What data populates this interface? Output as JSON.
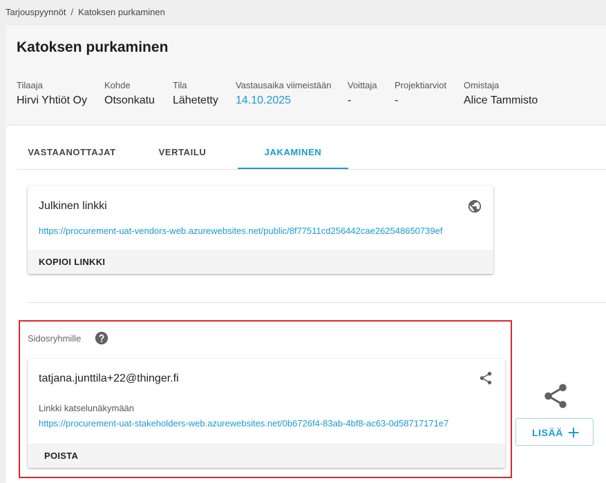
{
  "breadcrumb": {
    "items": [
      "Tarjouspyynnöt",
      "Katoksen purkaminen"
    ],
    "separator": "/"
  },
  "page": {
    "title": "Katoksen purkaminen"
  },
  "meta": [
    {
      "label": "Tilaaja",
      "value": "Hirvi Yhtiöt Oy"
    },
    {
      "label": "Kohde",
      "value": "Otsonkatu"
    },
    {
      "label": "Tila",
      "value": "Lähetetty"
    },
    {
      "label": "Vastausaika viimeistään",
      "value": "14.10.2025"
    },
    {
      "label": "Voittaja",
      "value": "-"
    },
    {
      "label": "Projektiarviot",
      "value": "-"
    },
    {
      "label": "Omistaja",
      "value": "Alice Tammisto"
    }
  ],
  "tabs": [
    {
      "label": "VASTAANOTTAJAT",
      "active": false
    },
    {
      "label": "VERTAILU",
      "active": false
    },
    {
      "label": "JAKAMINEN",
      "active": true
    }
  ],
  "public_link": {
    "title": "Julkinen linkki",
    "url": "https://procurement-uat-vendors-web.azurewebsites.net/public/8f77511cd256442cae262548650739ef",
    "copy_label": "KOPIOI LINKKI",
    "icon": "globe-icon"
  },
  "stakeholders": {
    "section_label": "Sidosryhmille",
    "help_icon": "help-icon",
    "items": [
      {
        "email": "tatjana.junttila+22@thinger.fi",
        "link_label": "Linkki katselunäkymään",
        "url": "https://procurement-uat-stakeholders-web.azurewebsites.net/0b6726f4-83ab-4bf8-ac63-0d58717171e7",
        "remove_label": "POISTA",
        "icon": "share-icon"
      }
    ],
    "add_label": "LISÄÄ"
  },
  "colors": {
    "accent": "#1a9ad6",
    "highlight": "#e0242a",
    "icon": "#616161"
  }
}
